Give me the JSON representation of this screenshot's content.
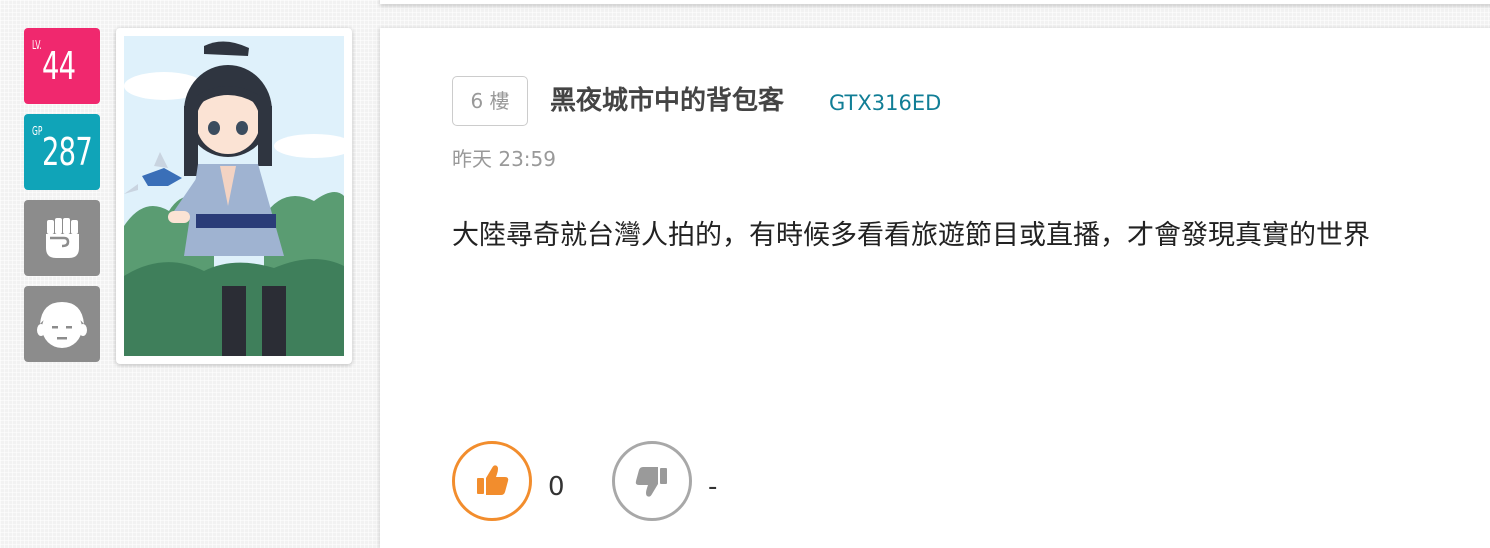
{
  "badges": {
    "level": {
      "prefix": "LV.",
      "value": "44",
      "color": "#f0286e"
    },
    "gp": {
      "prefix": "GP",
      "value": "287",
      "color": "#10a4b8"
    },
    "icons": [
      "fist-icon",
      "face-icon"
    ]
  },
  "post": {
    "floor": "6 樓",
    "author_name": "黑夜城市中的背包客",
    "author_id": "GTX316ED",
    "timestamp": "昨天 23:59",
    "content": "大陸尋奇就台灣人拍的，有時候多看看旅遊節目或直播，才會發現真實的世界",
    "likes": "0",
    "dislikes": "-"
  },
  "colors": {
    "accent": "#f28d2d",
    "link": "#117e96"
  }
}
